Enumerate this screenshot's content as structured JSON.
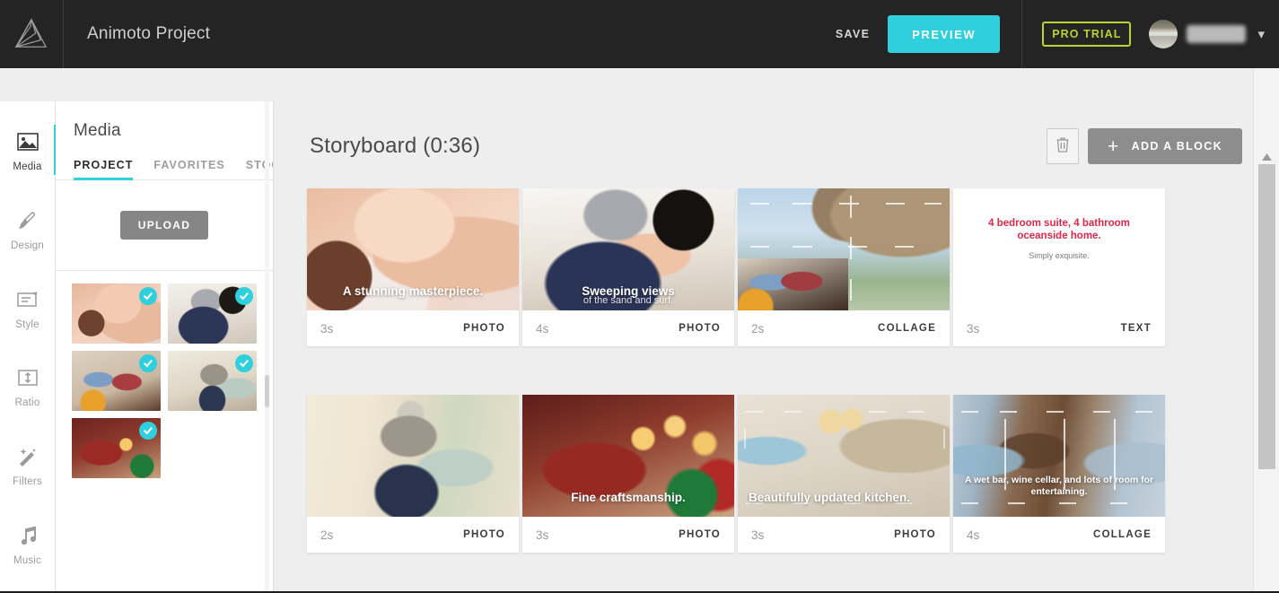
{
  "topbar": {
    "logo_icon": "animoto-logo-icon",
    "project_title": "Animoto Project",
    "save_label": "SAVE",
    "preview_label": "PREVIEW",
    "pro_trial_label": "PRO TRIAL",
    "avatar_icon": "user-avatar",
    "chevron_icon": "chevron-down-icon",
    "username": "",
    "colors": {
      "bg": "#242424",
      "preview": "#2fcfdd",
      "pro_trial": "#b7d433"
    }
  },
  "rail": {
    "items": [
      {
        "label": "Media",
        "icon": "image-icon",
        "active": true
      },
      {
        "label": "Design",
        "icon": "brush-icon",
        "active": false
      },
      {
        "label": "Style",
        "icon": "text-style-icon",
        "active": false
      },
      {
        "label": "Ratio",
        "icon": "aspect-ratio-icon",
        "active": false
      },
      {
        "label": "Filters",
        "icon": "magic-wand-icon",
        "active": false
      },
      {
        "label": "Music",
        "icon": "music-note-icon",
        "active": false
      }
    ]
  },
  "media_panel": {
    "title": "Media",
    "tabs": [
      {
        "label": "PROJECT",
        "active": true
      },
      {
        "label": "FAVORITES",
        "active": false
      },
      {
        "label": "STOCK",
        "active": false
      }
    ],
    "upload_label": "UPLOAD",
    "thumbnails": [
      {
        "name": "thumb-baby-hands",
        "selected": true
      },
      {
        "name": "thumb-pregnant-couple",
        "selected": true
      },
      {
        "name": "thumb-kitchen-couple",
        "selected": true
      },
      {
        "name": "thumb-elderly-couple",
        "selected": true
      },
      {
        "name": "thumb-child-christmas",
        "selected": true
      }
    ],
    "check_icon": "checkmark-icon"
  },
  "storyboard": {
    "title": "Storyboard (0:36)",
    "trash_icon": "trash-icon",
    "add_block_label": "ADD A BLOCK",
    "add_block_icon": "plus-icon",
    "cards": [
      {
        "duration": "3s",
        "kind": "PHOTO",
        "caption": "A stunning masterpiece.",
        "subcaption": "",
        "align": "center",
        "art": "baby-hands"
      },
      {
        "duration": "4s",
        "kind": "PHOTO",
        "caption": "Sweeping views",
        "subcaption": "of the sand and surf.",
        "align": "center",
        "art": "pregnant-couple"
      },
      {
        "duration": "2s",
        "kind": "COLLAGE",
        "caption": "",
        "subcaption": "",
        "align": "left",
        "art": "collage-ocean"
      },
      {
        "duration": "3s",
        "kind": "TEXT",
        "caption": "4 bedroom suite, 4 bathroom oceanside home.",
        "subcaption": "Simply exquisite.",
        "align": "center",
        "art": "text-slide"
      },
      {
        "duration": "2s",
        "kind": "PHOTO",
        "caption": "",
        "subcaption": "",
        "align": "left",
        "art": "elderly-couple"
      },
      {
        "duration": "3s",
        "kind": "PHOTO",
        "caption": "Fine craftsmanship.",
        "subcaption": "",
        "align": "center",
        "art": "child-christmas"
      },
      {
        "duration": "3s",
        "kind": "PHOTO",
        "caption": "Beautifully updated kitchen.",
        "subcaption": "",
        "align": "left",
        "art": "kitchen"
      },
      {
        "duration": "4s",
        "kind": "COLLAGE",
        "caption": "A wet bar, wine cellar, and lots of room for entertaining.",
        "subcaption": "",
        "align": "center",
        "art": "collage-winebar"
      }
    ]
  }
}
